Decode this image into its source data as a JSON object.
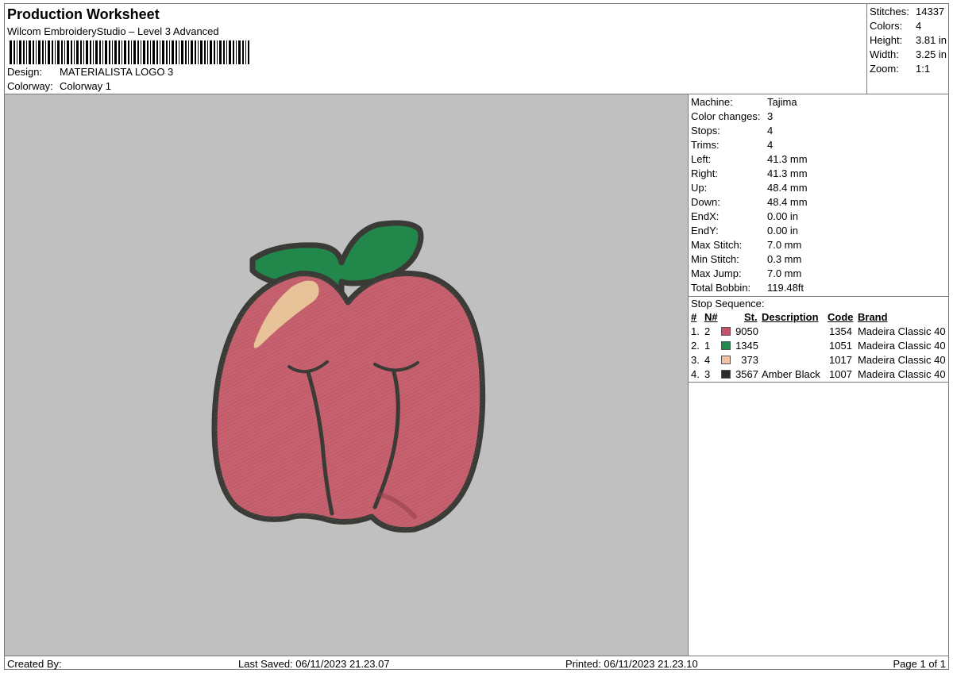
{
  "header": {
    "title": "Production Worksheet",
    "subtitle": "Wilcom EmbroideryStudio – Level 3 Advanced",
    "design_label": "Design:",
    "design_value": "MATERIALISTA LOGO 3",
    "colorway_label": "Colorway:",
    "colorway_value": "Colorway 1"
  },
  "stats": [
    {
      "label": "Stitches:",
      "value": "14337"
    },
    {
      "label": "Colors:",
      "value": "4"
    },
    {
      "label": "Height:",
      "value": "3.81 in"
    },
    {
      "label": "Width:",
      "value": "3.25 in"
    },
    {
      "label": "Zoom:",
      "value": "1:1"
    }
  ],
  "machine_info": [
    {
      "label": "Machine:",
      "value": "Tajima"
    },
    {
      "label": "Color changes:",
      "value": "3"
    },
    {
      "label": "Stops:",
      "value": "4"
    },
    {
      "label": "Trims:",
      "value": "4"
    },
    {
      "label": "Left:",
      "value": "41.3 mm"
    },
    {
      "label": "Right:",
      "value": "41.3 mm"
    },
    {
      "label": "Up:",
      "value": "48.4 mm"
    },
    {
      "label": "Down:",
      "value": "48.4 mm"
    },
    {
      "label": "EndX:",
      "value": "0.00 in"
    },
    {
      "label": "EndY:",
      "value": "0.00 in"
    },
    {
      "label": "Max Stitch:",
      "value": "7.0 mm"
    },
    {
      "label": "Min Stitch:",
      "value": "0.3 mm"
    },
    {
      "label": "Max Jump:",
      "value": "7.0 mm"
    },
    {
      "label": "Total Bobbin:",
      "value": "119.48ft"
    }
  ],
  "stop_sequence": {
    "title": "Stop Sequence:",
    "headers": {
      "num": "#",
      "n": "N#",
      "st": "St.",
      "description": "Description",
      "code": "Code",
      "brand": "Brand"
    },
    "rows": [
      {
        "num": "1.",
        "n": "2",
        "color": "#c8506a",
        "st": "9050",
        "description": "",
        "code": "1354",
        "brand": "Madeira Classic 40"
      },
      {
        "num": "2.",
        "n": "1",
        "color": "#1e8a4e",
        "st": "1345",
        "description": "",
        "code": "1051",
        "brand": "Madeira Classic 40"
      },
      {
        "num": "3.",
        "n": "4",
        "color": "#f2c0a4",
        "st": "373",
        "description": "",
        "code": "1017",
        "brand": "Madeira Classic 40"
      },
      {
        "num": "4.",
        "n": "3",
        "color": "#2b2b2b",
        "st": "3567",
        "description": "Amber Black",
        "code": "1007",
        "brand": "Madeira Classic 40"
      }
    ]
  },
  "footer": {
    "created_by": "Created By:",
    "last_saved": "Last Saved: 06/11/2023 21.23.07",
    "printed": "Printed: 06/11/2023 21.23.10",
    "page": "Page 1 of 1"
  },
  "colors": {
    "preview_background": "#c0c0c0",
    "peach_fill": "#c45d6b",
    "leaf_fill": "#22874a",
    "highlight_fill": "#e8c39a",
    "outline": "#3a3a36"
  }
}
